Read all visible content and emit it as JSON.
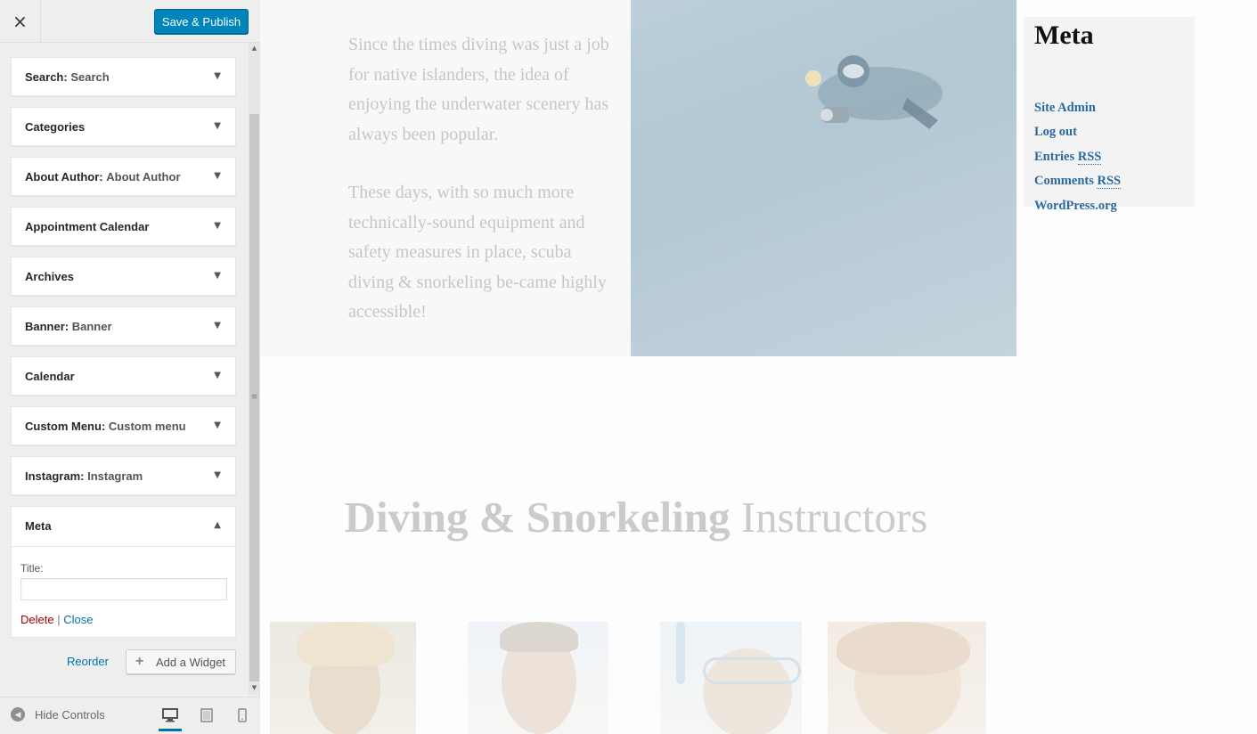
{
  "customizer": {
    "save_button": "Save & Publish",
    "close_glyph": "×",
    "widgets": [
      {
        "name": "Search",
        "subtitle": "Search"
      },
      {
        "name": "Categories",
        "subtitle": ""
      },
      {
        "name": "About Author",
        "subtitle": "About Author"
      },
      {
        "name": "Appointment Calendar",
        "subtitle": ""
      },
      {
        "name": "Archives",
        "subtitle": ""
      },
      {
        "name": "Banner",
        "subtitle": "Banner"
      },
      {
        "name": "Calendar",
        "subtitle": ""
      },
      {
        "name": "Custom Menu",
        "subtitle": "Custom menu"
      },
      {
        "name": "Instagram",
        "subtitle": "Instagram"
      }
    ],
    "open_widget": {
      "name": "Meta",
      "title_label": "Title:",
      "title_value": "",
      "delete_label": "Delete",
      "separator": "|",
      "close_label": "Close"
    },
    "reorder_label": "Reorder",
    "add_widget_label": "Add a Widget",
    "hide_controls_label": "Hide Controls",
    "active_device": "desktop",
    "accent_color": "#0085ba"
  },
  "preview": {
    "intro_paragraphs": [
      "Since the times diving was just a job for native islanders, the idea of enjoying the underwater scenery has always been popular.",
      "These days, with so much more technically-sound equipment and safety measures in place, scuba diving & snorkeling be-came highly accessible!"
    ],
    "meta_widget": {
      "heading": "Meta",
      "links": [
        {
          "text": "Site Admin",
          "abbr": ""
        },
        {
          "text": "Log out",
          "abbr": ""
        },
        {
          "text": "Entries ",
          "abbr": "RSS"
        },
        {
          "text": "Comments ",
          "abbr": "RSS"
        },
        {
          "text": "WordPress.org",
          "abbr": ""
        }
      ]
    },
    "section_title_bold": "Diving & Snorkeling",
    "section_title_light": "Instructors",
    "instructors_count_visible": 4
  }
}
